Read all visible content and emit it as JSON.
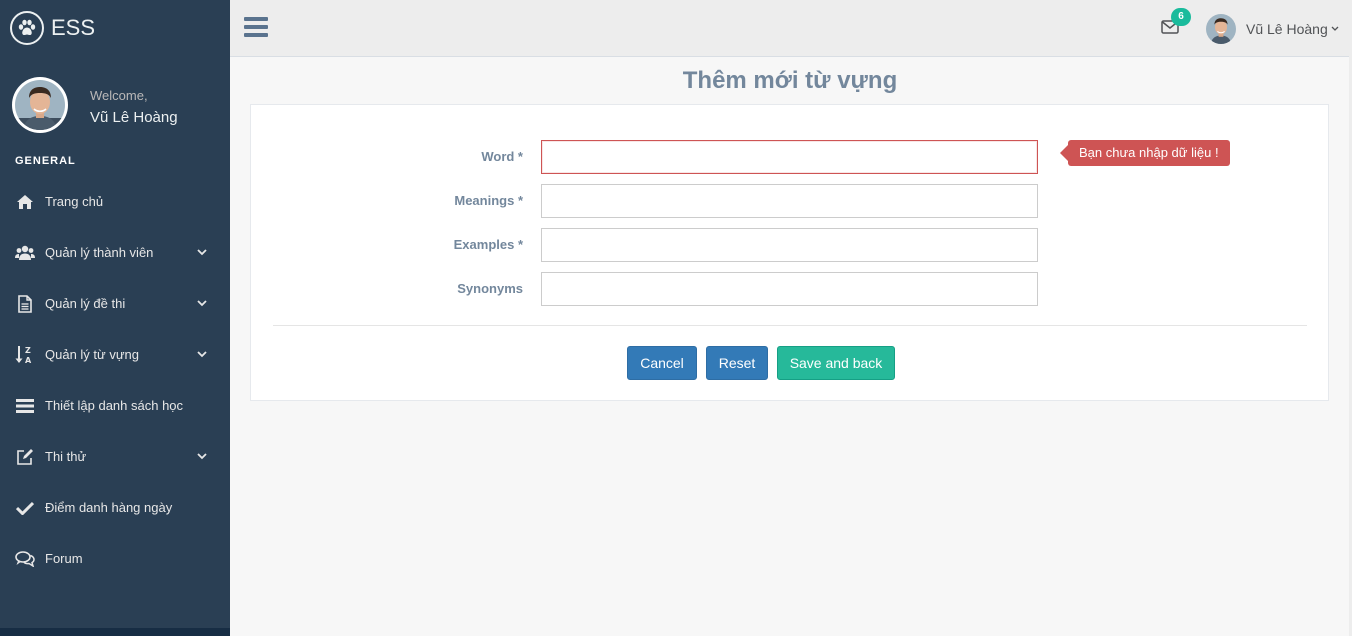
{
  "brand": {
    "title": "ESS",
    "icon": "paw-icon"
  },
  "profile": {
    "welcome": "Welcome,",
    "name": "Vũ Lê Hoàng"
  },
  "sidebar": {
    "section_title": "GENERAL",
    "items": [
      {
        "label": "Trang chủ",
        "icon": "home-icon",
        "expandable": false
      },
      {
        "label": "Quản lý thành viên",
        "icon": "users-icon",
        "expandable": true
      },
      {
        "label": "Quản lý đề thi",
        "icon": "document-icon",
        "expandable": true
      },
      {
        "label": "Quản lý từ vựng",
        "icon": "sort-alpha-icon",
        "expandable": true
      },
      {
        "label": "Thiết lập danh sách học",
        "icon": "list-icon",
        "expandable": false
      },
      {
        "label": "Thi thử",
        "icon": "edit-icon",
        "expandable": true
      },
      {
        "label": "Điểm danh hàng ngày",
        "icon": "check-icon",
        "expandable": false
      },
      {
        "label": "Forum",
        "icon": "comments-icon",
        "expandable": false
      }
    ]
  },
  "topnav": {
    "notification_count": "6",
    "user_name": "Vũ Lê Hoàng"
  },
  "page": {
    "title": "Thêm mới từ vựng",
    "fields": [
      {
        "label": "Word *",
        "value": "",
        "error": true
      },
      {
        "label": "Meanings *",
        "value": "",
        "error": false
      },
      {
        "label": "Examples *",
        "value": "",
        "error": false
      },
      {
        "label": "Synonyms",
        "value": "",
        "error": false
      }
    ],
    "error_tooltip": "Bạn chưa nhập dữ liệu !",
    "buttons": {
      "cancel": "Cancel",
      "reset": "Reset",
      "save": "Save and back"
    }
  },
  "colors": {
    "sidebar_bg": "#2A3F54",
    "accent_green": "#26B99A",
    "primary_blue": "#337AB7",
    "error_red": "#CE5454"
  }
}
